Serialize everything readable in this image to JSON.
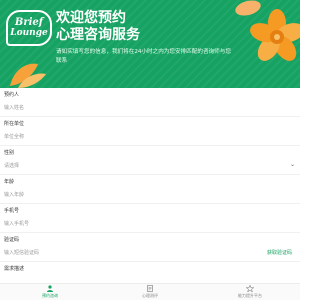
{
  "banner": {
    "logo_line1": "Brief",
    "logo_line2": "Lounge",
    "headline_line1": "欢迎您预约",
    "headline_line2": "心理咨询服务",
    "subtext": "请如实填写您的信息，我们将在24小时之内为您安排匹配的咨询师与您联系"
  },
  "form": {
    "fields": [
      {
        "label": "预约人",
        "placeholder": "输入姓名"
      },
      {
        "label": "所在单位",
        "placeholder": "单位全称"
      },
      {
        "label": "性别",
        "placeholder": "请选择"
      },
      {
        "label": "年龄",
        "placeholder": "输入年龄"
      },
      {
        "label": "手机号",
        "placeholder": "输入手机号"
      },
      {
        "label": "验证码",
        "placeholder": "输入短信验证码",
        "action": "获取验证码"
      },
      {
        "label": "需求描述",
        "placeholder": ""
      }
    ]
  },
  "nav": {
    "items": [
      {
        "label": "预约咨询",
        "icon": "user-icon"
      },
      {
        "label": "心理测评",
        "icon": "document-icon"
      },
      {
        "label": "能力提升平台",
        "icon": "star-icon"
      }
    ]
  },
  "colors": {
    "brand": "#16a262",
    "accent": "#f7a23a"
  }
}
